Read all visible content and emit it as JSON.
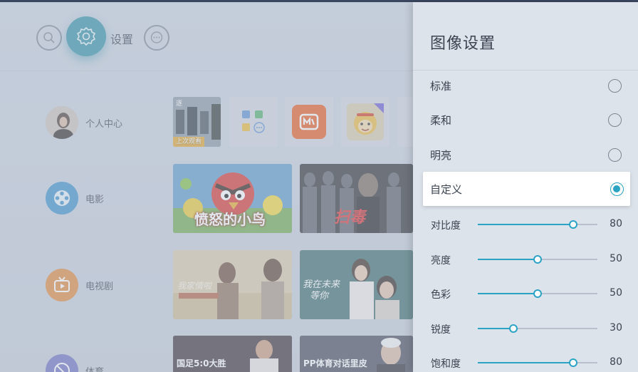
{
  "topbar": {
    "settings_label": "设置"
  },
  "sidebar": {
    "items": [
      {
        "label": "个人中心"
      },
      {
        "label": "电影"
      },
      {
        "label": "电视剧"
      },
      {
        "label": "体育"
      }
    ]
  },
  "content": {
    "recent_caption": "上次观看",
    "movie1_title": "愤怒的小鸟",
    "movie2_title": "扫毒",
    "sports1_caption": "国足5:0大胜",
    "sports2_caption": "PP体育对话里皮"
  },
  "panel": {
    "title": "图像设置",
    "modes": [
      {
        "label": "标准",
        "selected": false
      },
      {
        "label": "柔和",
        "selected": false
      },
      {
        "label": "明亮",
        "selected": false
      },
      {
        "label": "自定义",
        "selected": true
      }
    ],
    "sliders": [
      {
        "label": "对比度",
        "value": "80",
        "level": 80
      },
      {
        "label": "亮度",
        "value": "50",
        "level": 50
      },
      {
        "label": "色彩",
        "value": "50",
        "level": 50
      },
      {
        "label": "锐度",
        "value": "30",
        "level": 30
      },
      {
        "label": "饱和度",
        "value": "80",
        "level": 80
      }
    ]
  },
  "colors": {
    "accent": "#2aa3c4",
    "settings_button": "#2e8fa3",
    "movie_icon": "#3a8fc9",
    "tv_icon": "#e0873a",
    "sports_icon": "#6a6ec0"
  }
}
